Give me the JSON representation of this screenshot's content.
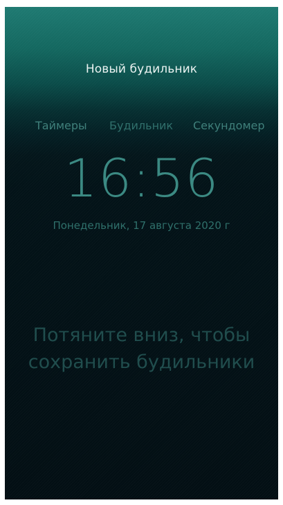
{
  "pulley_menu": {
    "new_alarm_label": "Новый будильник"
  },
  "tabs": [
    {
      "label": "Таймеры"
    },
    {
      "label": "Будильник"
    },
    {
      "label": "Секундомер"
    }
  ],
  "clock": {
    "time": "16:56",
    "date": "Понедельник, 17 августа 2020 г"
  },
  "empty_state": {
    "line1": "Потяните вниз, чтобы",
    "line2": "сохранить будильники"
  },
  "colors": {
    "accent": "#3a8982",
    "header_gradient_top": "#1f7a72",
    "background": "#030f14"
  }
}
